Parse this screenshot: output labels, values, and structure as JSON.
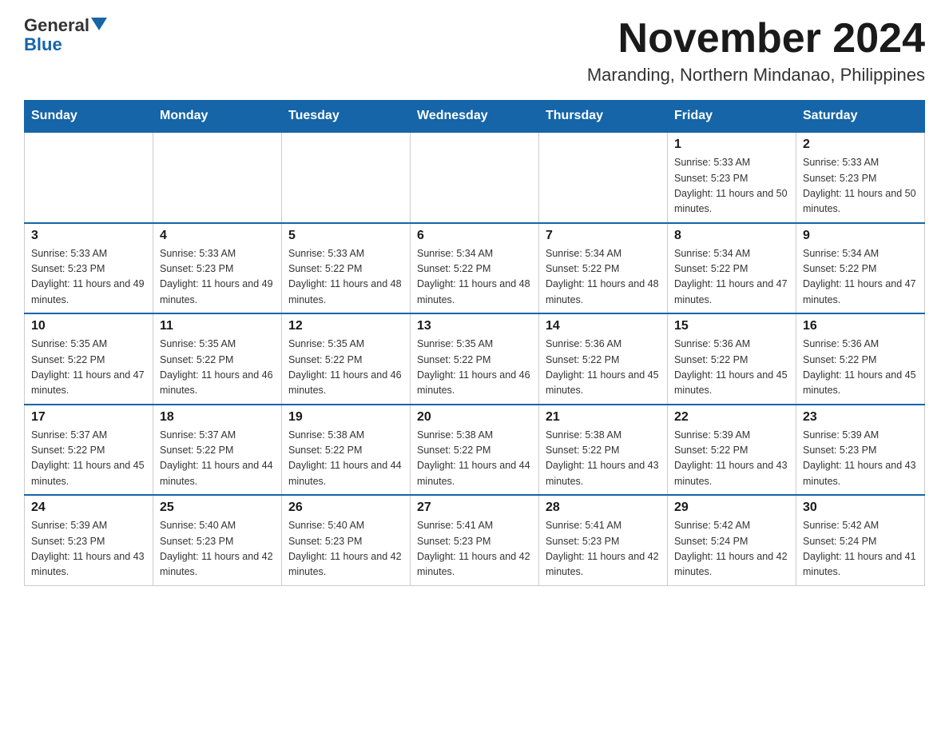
{
  "logo": {
    "general": "General",
    "blue": "Blue"
  },
  "title": {
    "month": "November 2024",
    "location": "Maranding, Northern Mindanao, Philippines"
  },
  "weekdays": [
    "Sunday",
    "Monday",
    "Tuesday",
    "Wednesday",
    "Thursday",
    "Friday",
    "Saturday"
  ],
  "weeks": [
    [
      {
        "day": "",
        "info": ""
      },
      {
        "day": "",
        "info": ""
      },
      {
        "day": "",
        "info": ""
      },
      {
        "day": "",
        "info": ""
      },
      {
        "day": "",
        "info": ""
      },
      {
        "day": "1",
        "info": "Sunrise: 5:33 AM\nSunset: 5:23 PM\nDaylight: 11 hours and 50 minutes."
      },
      {
        "day": "2",
        "info": "Sunrise: 5:33 AM\nSunset: 5:23 PM\nDaylight: 11 hours and 50 minutes."
      }
    ],
    [
      {
        "day": "3",
        "info": "Sunrise: 5:33 AM\nSunset: 5:23 PM\nDaylight: 11 hours and 49 minutes."
      },
      {
        "day": "4",
        "info": "Sunrise: 5:33 AM\nSunset: 5:23 PM\nDaylight: 11 hours and 49 minutes."
      },
      {
        "day": "5",
        "info": "Sunrise: 5:33 AM\nSunset: 5:22 PM\nDaylight: 11 hours and 48 minutes."
      },
      {
        "day": "6",
        "info": "Sunrise: 5:34 AM\nSunset: 5:22 PM\nDaylight: 11 hours and 48 minutes."
      },
      {
        "day": "7",
        "info": "Sunrise: 5:34 AM\nSunset: 5:22 PM\nDaylight: 11 hours and 48 minutes."
      },
      {
        "day": "8",
        "info": "Sunrise: 5:34 AM\nSunset: 5:22 PM\nDaylight: 11 hours and 47 minutes."
      },
      {
        "day": "9",
        "info": "Sunrise: 5:34 AM\nSunset: 5:22 PM\nDaylight: 11 hours and 47 minutes."
      }
    ],
    [
      {
        "day": "10",
        "info": "Sunrise: 5:35 AM\nSunset: 5:22 PM\nDaylight: 11 hours and 47 minutes."
      },
      {
        "day": "11",
        "info": "Sunrise: 5:35 AM\nSunset: 5:22 PM\nDaylight: 11 hours and 46 minutes."
      },
      {
        "day": "12",
        "info": "Sunrise: 5:35 AM\nSunset: 5:22 PM\nDaylight: 11 hours and 46 minutes."
      },
      {
        "day": "13",
        "info": "Sunrise: 5:35 AM\nSunset: 5:22 PM\nDaylight: 11 hours and 46 minutes."
      },
      {
        "day": "14",
        "info": "Sunrise: 5:36 AM\nSunset: 5:22 PM\nDaylight: 11 hours and 45 minutes."
      },
      {
        "day": "15",
        "info": "Sunrise: 5:36 AM\nSunset: 5:22 PM\nDaylight: 11 hours and 45 minutes."
      },
      {
        "day": "16",
        "info": "Sunrise: 5:36 AM\nSunset: 5:22 PM\nDaylight: 11 hours and 45 minutes."
      }
    ],
    [
      {
        "day": "17",
        "info": "Sunrise: 5:37 AM\nSunset: 5:22 PM\nDaylight: 11 hours and 45 minutes."
      },
      {
        "day": "18",
        "info": "Sunrise: 5:37 AM\nSunset: 5:22 PM\nDaylight: 11 hours and 44 minutes."
      },
      {
        "day": "19",
        "info": "Sunrise: 5:38 AM\nSunset: 5:22 PM\nDaylight: 11 hours and 44 minutes."
      },
      {
        "day": "20",
        "info": "Sunrise: 5:38 AM\nSunset: 5:22 PM\nDaylight: 11 hours and 44 minutes."
      },
      {
        "day": "21",
        "info": "Sunrise: 5:38 AM\nSunset: 5:22 PM\nDaylight: 11 hours and 43 minutes."
      },
      {
        "day": "22",
        "info": "Sunrise: 5:39 AM\nSunset: 5:22 PM\nDaylight: 11 hours and 43 minutes."
      },
      {
        "day": "23",
        "info": "Sunrise: 5:39 AM\nSunset: 5:23 PM\nDaylight: 11 hours and 43 minutes."
      }
    ],
    [
      {
        "day": "24",
        "info": "Sunrise: 5:39 AM\nSunset: 5:23 PM\nDaylight: 11 hours and 43 minutes."
      },
      {
        "day": "25",
        "info": "Sunrise: 5:40 AM\nSunset: 5:23 PM\nDaylight: 11 hours and 42 minutes."
      },
      {
        "day": "26",
        "info": "Sunrise: 5:40 AM\nSunset: 5:23 PM\nDaylight: 11 hours and 42 minutes."
      },
      {
        "day": "27",
        "info": "Sunrise: 5:41 AM\nSunset: 5:23 PM\nDaylight: 11 hours and 42 minutes."
      },
      {
        "day": "28",
        "info": "Sunrise: 5:41 AM\nSunset: 5:23 PM\nDaylight: 11 hours and 42 minutes."
      },
      {
        "day": "29",
        "info": "Sunrise: 5:42 AM\nSunset: 5:24 PM\nDaylight: 11 hours and 42 minutes."
      },
      {
        "day": "30",
        "info": "Sunrise: 5:42 AM\nSunset: 5:24 PM\nDaylight: 11 hours and 41 minutes."
      }
    ]
  ]
}
